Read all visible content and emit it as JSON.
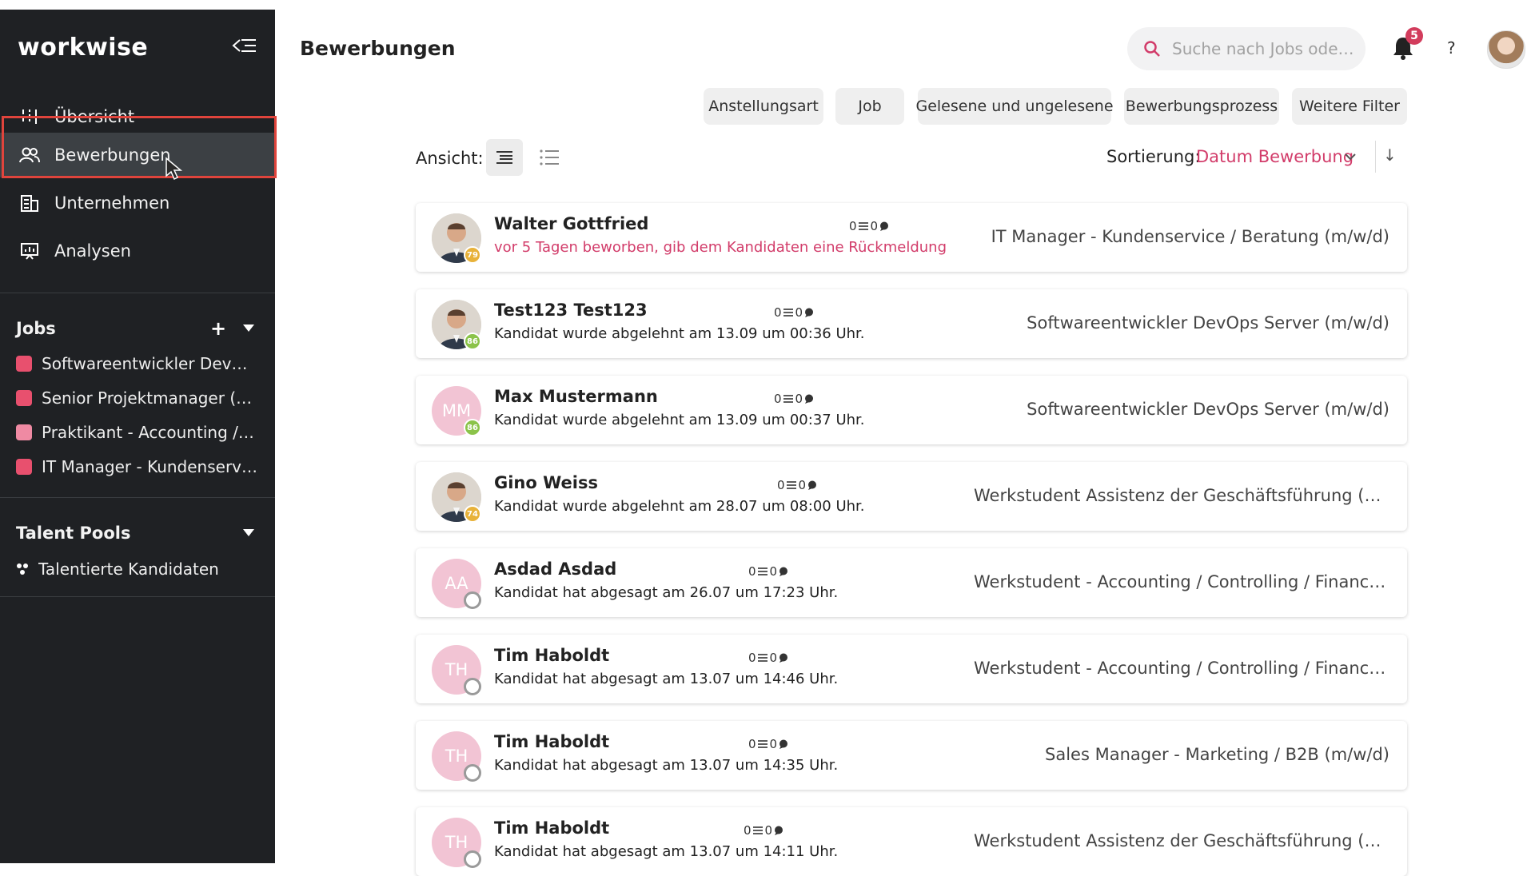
{
  "sidebar": {
    "logo": "workwise",
    "nav": [
      {
        "label": "Übersicht",
        "icon": "overview-icon"
      },
      {
        "label": "Bewerbungen",
        "icon": "users-icon"
      },
      {
        "label": "Unternehmen",
        "icon": "building-icon"
      },
      {
        "label": "Analysen",
        "icon": "chart-icon"
      }
    ],
    "jobs_heading": "Jobs",
    "add_symbol": "+",
    "jobs": [
      {
        "label": "Softwareentwickler DevOps Server (m/w/d)",
        "color": "#e8506e"
      },
      {
        "label": "Senior Projektmanager (m/w/d)",
        "color": "#e8506e"
      },
      {
        "label": "Praktikant - Accounting / Controlling",
        "color": "#ef8aa3"
      },
      {
        "label": "IT Manager - Kundenservice / Beratung (m/w/d)",
        "color": "#e8506e"
      }
    ],
    "talent_pools_heading": "Talent Pools",
    "talent_pools": [
      {
        "label": "Talentierte Kandidaten",
        "icon": "talent-pool-icon"
      }
    ]
  },
  "header": {
    "title": "Bewerbungen",
    "search_placeholder": "Suche nach Jobs ode…",
    "notification_count": "5",
    "help_label": "?"
  },
  "filters": [
    "Anstellungsart",
    "Job",
    "Gelesene und ungelesene",
    "Bewerbungsprozess",
    "Weitere Filter"
  ],
  "view": {
    "label": "Ansicht:"
  },
  "sort": {
    "label": "Sortierung:",
    "value": "Datum Bewerbung",
    "direction": "↓"
  },
  "colors": {
    "accent": "#d23c6a",
    "sidebar_bg": "#1f2124",
    "highlight": "#e0443c"
  },
  "applications": [
    {
      "name": "Walter Gottfried",
      "status": "vor 5 Tagen beworben, gib dem Kandidaten eine Rückmeldung",
      "status_alert": true,
      "notes": "0",
      "messages": "0",
      "job": "IT Manager - Kundenservice / Beratung (m/w/d)",
      "avatar_type": "photo",
      "initials": "",
      "score": "79",
      "score_color": "#e8b23a"
    },
    {
      "name": "Test123 Test123",
      "status": "Kandidat wurde abgelehnt am 13.09 um 00:36 Uhr.",
      "status_alert": false,
      "notes": "0",
      "messages": "0",
      "job": "Softwareentwickler DevOps Server (m/w/d)",
      "avatar_type": "photo",
      "initials": "",
      "score": "86",
      "score_color": "#8bc34a"
    },
    {
      "name": "Max Mustermann",
      "status": "Kandidat wurde abgelehnt am 13.09 um 00:37 Uhr.",
      "status_alert": false,
      "notes": "0",
      "messages": "0",
      "job": "Softwareentwickler DevOps Server (m/w/d)",
      "avatar_type": "initials",
      "initials": "MM",
      "score": "86",
      "score_color": "#8bc34a"
    },
    {
      "name": "Gino Weiss",
      "status": "Kandidat wurde abgelehnt am 28.07 um 08:00 Uhr.",
      "status_alert": false,
      "notes": "0",
      "messages": "0",
      "job": "Werkstudent Assistenz der Geschäftsführung (m/w/d)",
      "avatar_type": "photo",
      "initials": "",
      "score": "74",
      "score_color": "#e8b23a"
    },
    {
      "name": "Asdad Asdad",
      "status": "Kandidat hat abgesagt am 26.07 um 17:23 Uhr.",
      "status_alert": false,
      "notes": "0",
      "messages": "0",
      "job": "Werkstudent - Accounting / Controlling / Finance (…",
      "avatar_type": "initials",
      "initials": "AA",
      "score": "",
      "score_color": "#9a9a9a"
    },
    {
      "name": "Tim Haboldt",
      "status": "Kandidat hat abgesagt am 13.07 um 14:46 Uhr.",
      "status_alert": false,
      "notes": "0",
      "messages": "0",
      "job": "Werkstudent - Accounting / Controlling / Finance (…",
      "avatar_type": "initials",
      "initials": "TH",
      "score": "",
      "score_color": "#9a9a9a"
    },
    {
      "name": "Tim Haboldt",
      "status": "Kandidat hat abgesagt am 13.07 um 14:35 Uhr.",
      "status_alert": false,
      "notes": "0",
      "messages": "0",
      "job": "Sales Manager - Marketing / B2B (m/w/d)",
      "avatar_type": "initials",
      "initials": "TH",
      "score": "",
      "score_color": "#9a9a9a"
    },
    {
      "name": "Tim Haboldt",
      "status": "Kandidat hat abgesagt am 13.07 um 14:11 Uhr.",
      "status_alert": false,
      "notes": "0",
      "messages": "0",
      "job": "Werkstudent Assistenz der Geschäftsführung (m/w/d)",
      "avatar_type": "initials",
      "initials": "TH",
      "score": "",
      "score_color": "#9a9a9a"
    }
  ]
}
